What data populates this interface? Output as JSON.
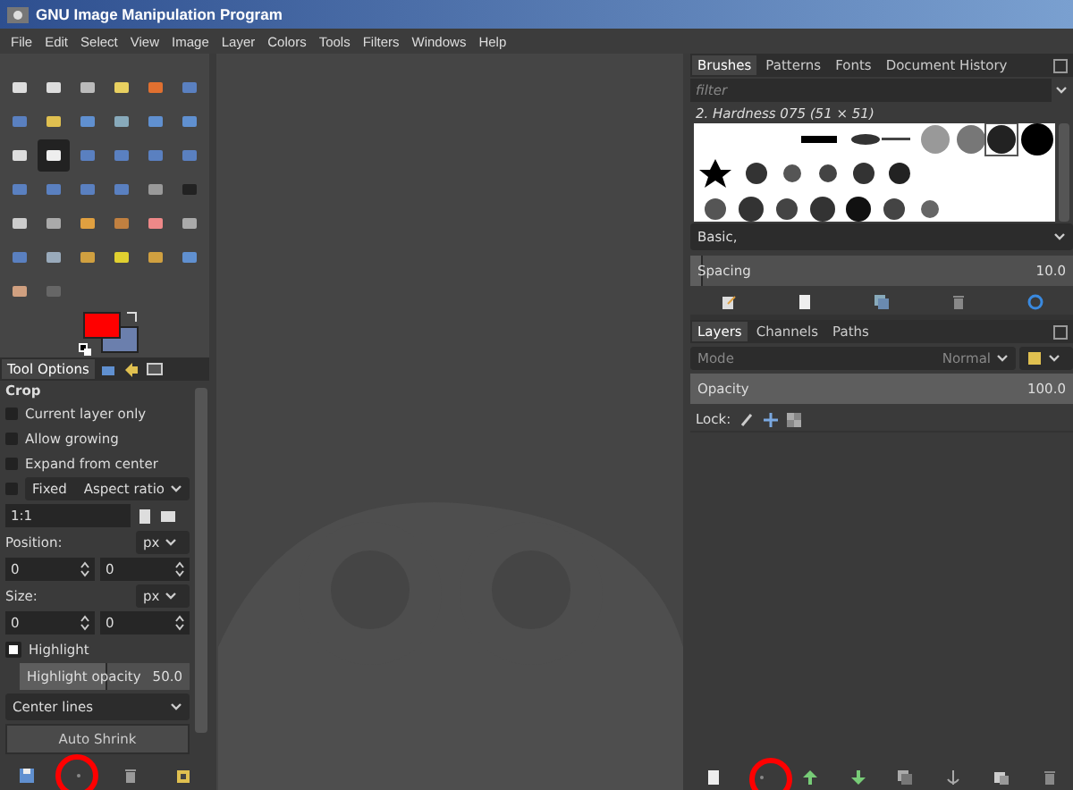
{
  "window": {
    "title": "GNU Image Manipulation Program"
  },
  "menu": [
    "File",
    "Edit",
    "Select",
    "View",
    "Image",
    "Layer",
    "Colors",
    "Tools",
    "Filters",
    "Windows",
    "Help"
  ],
  "tools": [
    {
      "selected": false
    },
    {
      "selected": false
    },
    {
      "selected": false
    },
    {
      "selected": false
    },
    {
      "selected": false
    },
    {
      "selected": false
    },
    {
      "selected": false
    },
    {
      "selected": false
    },
    {
      "selected": false
    },
    {
      "selected": false
    },
    {
      "selected": false
    },
    {
      "selected": false
    },
    {
      "selected": false
    },
    {
      "selected": true
    },
    {
      "selected": false
    },
    {
      "selected": false
    },
    {
      "selected": false
    },
    {
      "selected": false
    },
    {
      "selected": false
    },
    {
      "selected": false
    },
    {
      "selected": false
    },
    {
      "selected": false
    },
    {
      "selected": false
    },
    {
      "selected": false
    },
    {
      "selected": false
    },
    {
      "selected": false
    },
    {
      "selected": false
    },
    {
      "selected": false
    },
    {
      "selected": false
    },
    {
      "selected": false
    },
    {
      "selected": false
    },
    {
      "selected": false
    },
    {
      "selected": false
    },
    {
      "selected": false
    },
    {
      "selected": false
    },
    {
      "selected": false
    },
    {
      "selected": false
    },
    {
      "selected": false
    }
  ],
  "tool_options": {
    "tab": {
      "label": "Tool Options",
      "selected": true
    },
    "title": "Crop",
    "options": [
      {
        "label": "Current layer only",
        "checked": false
      },
      {
        "label": "Allow growing",
        "checked": false
      },
      {
        "label": "Expand from center",
        "checked": false
      }
    ],
    "fixed": {
      "label": "Fixed",
      "checked": false,
      "value": "Aspect ratio"
    },
    "ratio": "1:1",
    "position": {
      "label": "Position:",
      "unit": "px",
      "values": [
        "0",
        "0"
      ]
    },
    "size": {
      "label": "Size:",
      "unit": "px",
      "values": [
        "0",
        "0"
      ]
    },
    "highlight": {
      "label": "Highlight",
      "checked": true
    },
    "highlight_opacity": {
      "label": "Highlight opacity",
      "reading": "50.0",
      "level": 0.5
    },
    "guides": "Center lines",
    "button": "Auto Shrink"
  },
  "brushes": {
    "tabs": [
      {
        "label": "Brushes",
        "selected": true
      },
      {
        "label": "Patterns",
        "selected": false
      },
      {
        "label": "Fonts",
        "selected": false
      },
      {
        "label": "Document History",
        "selected": false
      }
    ],
    "filter": {
      "placeholder": "filter"
    },
    "brush_name": "2. Hardness 075 (51 × 51)",
    "preset": "Basic,",
    "spacing": {
      "label": "Spacing",
      "reading": "10.0",
      "level": 0.03
    }
  },
  "layers": {
    "tabs": [
      {
        "label": "Layers",
        "selected": true
      },
      {
        "label": "Channels",
        "selected": false
      },
      {
        "label": "Paths",
        "selected": false
      }
    ],
    "mode": {
      "label": "Mode",
      "value": "Normal"
    },
    "opacity": {
      "label": "Opacity",
      "reading": "100.0",
      "level": 1
    },
    "lock_label": "Lock:"
  }
}
